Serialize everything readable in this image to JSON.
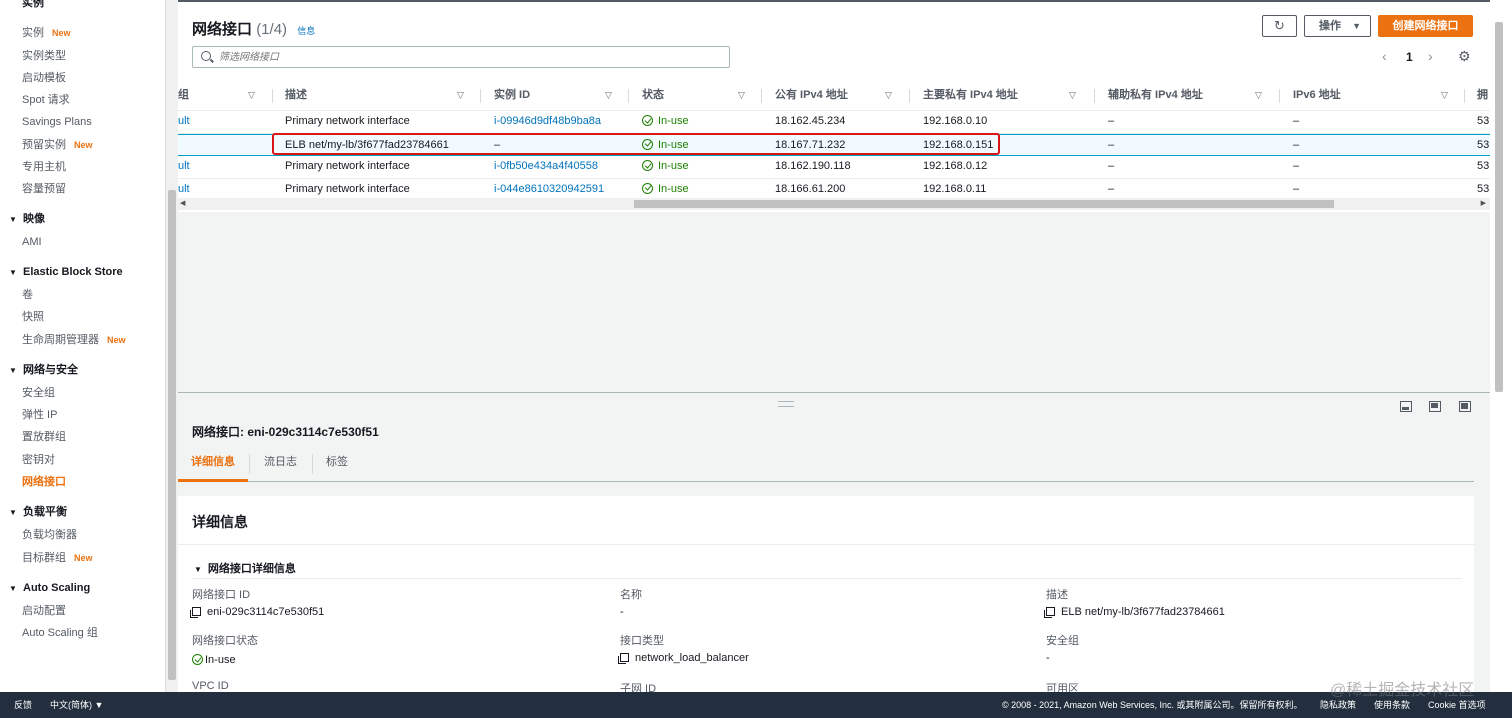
{
  "sidebar": {
    "top_cut": "实例",
    "items": [
      {
        "label": "实例",
        "new": "New"
      },
      {
        "label": "实例类型"
      },
      {
        "label": "启动模板"
      },
      {
        "label": "Spot 请求"
      },
      {
        "label": "Savings Plans"
      },
      {
        "label": "预留实例",
        "new": "New"
      },
      {
        "label": "专用主机"
      },
      {
        "label": "容量预留"
      }
    ],
    "sections": {
      "images": {
        "title": "映像",
        "items": [
          "AMI"
        ]
      },
      "ebs": {
        "title": "Elastic Block Store",
        "items": [
          "卷",
          "快照",
          "生命周期管理器"
        ],
        "new": "New"
      },
      "network": {
        "title": "网络与安全",
        "items": [
          "安全组",
          "弹性 IP",
          "置放群组",
          "密钥对",
          "网络接口"
        ]
      },
      "lb": {
        "title": "负载平衡",
        "items": [
          "负载均衡器",
          "目标群组"
        ],
        "new": "New"
      },
      "autoscaling": {
        "title": "Auto Scaling",
        "items": [
          "启动配置",
          "Auto Scaling 组"
        ]
      }
    }
  },
  "header": {
    "title": "网络接口",
    "count": "(1/4)",
    "info": "信息",
    "search_placeholder": "筛选网络接口",
    "actions_label": "操作",
    "create_label": "创建网络接口",
    "page": "1"
  },
  "table": {
    "columns": [
      "组",
      "描述",
      "实例 ID",
      "状态",
      "公有 IPv4 地址",
      "主要私有 IPv4 地址",
      "辅助私有 IPv4 地址",
      "IPv6 地址",
      "拥"
    ],
    "rows": [
      {
        "group": "ult",
        "desc": "Primary network interface",
        "instance": "i-09946d9df48b9ba8a",
        "status": "In-use",
        "public_ip": "18.162.45.234",
        "private_ip": "192.168.0.10",
        "secondary": "–",
        "ipv6": "–",
        "owner": "53"
      },
      {
        "group": "",
        "desc": "ELB net/my-lb/3f677fad23784661",
        "instance": "–",
        "status": "In-use",
        "public_ip": "18.167.71.232",
        "private_ip": "192.168.0.151",
        "secondary": "–",
        "ipv6": "–",
        "owner": "53"
      },
      {
        "group": "ult",
        "desc": "Primary network interface",
        "instance": "i-0fb50e434a4f40558",
        "status": "In-use",
        "public_ip": "18.162.190.118",
        "private_ip": "192.168.0.12",
        "secondary": "–",
        "ipv6": "–",
        "owner": "53"
      },
      {
        "group": "ult",
        "desc": "Primary network interface",
        "instance": "i-044e8610320942591",
        "status": "In-use",
        "public_ip": "18.166.61.200",
        "private_ip": "192.168.0.11",
        "secondary": "–",
        "ipv6": "–",
        "owner": "53"
      }
    ]
  },
  "detail": {
    "title": "网络接口: eni-029c3114c7e530f51",
    "tabs": [
      "详细信息",
      "流日志",
      "标签"
    ],
    "heading": "详细信息",
    "subheading": "网络接口详细信息",
    "fields": {
      "eni_id_label": "网络接口 ID",
      "eni_id_value": "eni-029c3114c7e530f51",
      "name_label": "名称",
      "name_value": "-",
      "desc_label": "描述",
      "desc_value": "ELB net/my-lb/3f677fad23784661",
      "status_label": "网络接口状态",
      "status_value": "In-use",
      "type_label": "接口类型",
      "type_value": "network_load_balancer",
      "sg_label": "安全组",
      "sg_value": "-",
      "vpc_label": "VPC ID",
      "subnet_label": "子网 ID",
      "az_label": "可用区"
    }
  },
  "footer": {
    "feedback": "反馈",
    "language": "中文(简体)",
    "copyright": "© 2008 - 2021, Amazon Web Services, Inc. 或其附属公司。保留所有权利。",
    "privacy": "隐私政策",
    "terms": "使用条款",
    "cookie": "Cookie 首选项"
  },
  "watermark": "@稀土掘金技术社区",
  "colors": {
    "accent": "#ec7211",
    "link": "#0073bb",
    "success": "#1d8102",
    "highlight": "#d91515",
    "footer_bg": "#232f3e"
  }
}
